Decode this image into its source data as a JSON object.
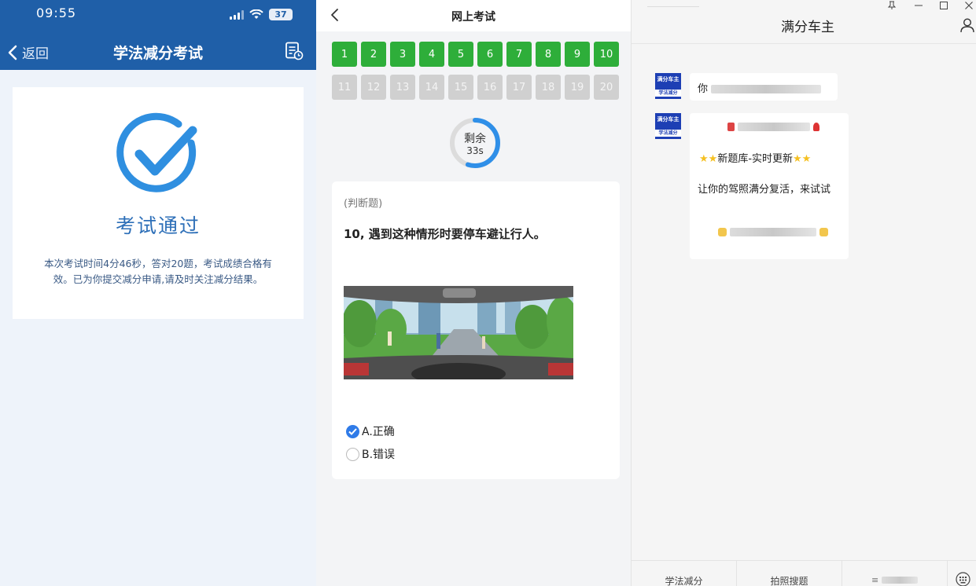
{
  "phone": {
    "status_time": "09:55",
    "battery": "37",
    "back_label": "返回",
    "title": "学法减分考试",
    "result_title": "考试通过",
    "result_detail": "本次考试时间4分46秒，答对20题，考试成绩合格有效。已为你提交减分申请,请及时关注减分结果。"
  },
  "exam": {
    "title": "网上考试",
    "questions": [
      {
        "num": "1",
        "state": "done"
      },
      {
        "num": "2",
        "state": "done"
      },
      {
        "num": "3",
        "state": "done"
      },
      {
        "num": "4",
        "state": "done"
      },
      {
        "num": "5",
        "state": "done"
      },
      {
        "num": "6",
        "state": "done"
      },
      {
        "num": "7",
        "state": "done"
      },
      {
        "num": "8",
        "state": "done"
      },
      {
        "num": "9",
        "state": "done"
      },
      {
        "num": "10",
        "state": "done"
      },
      {
        "num": "11",
        "state": "todo"
      },
      {
        "num": "12",
        "state": "todo"
      },
      {
        "num": "13",
        "state": "todo"
      },
      {
        "num": "14",
        "state": "todo"
      },
      {
        "num": "15",
        "state": "todo"
      },
      {
        "num": "16",
        "state": "todo"
      },
      {
        "num": "17",
        "state": "todo"
      },
      {
        "num": "18",
        "state": "todo"
      },
      {
        "num": "19",
        "state": "todo"
      },
      {
        "num": "20",
        "state": "todo"
      }
    ],
    "timer_label": "剩余",
    "timer_value": "33s",
    "timer_fraction": 0.55,
    "question_type": "(判断题)",
    "question_text": "10, 遇到这种情形时要停车避让行人。",
    "option_a": "A.正确",
    "option_b": "B.错误",
    "selected": "A"
  },
  "chat": {
    "title": "满分车主",
    "avatar_line1": "满分车主",
    "avatar_line2": "学法减分",
    "msg1_visible": "你",
    "msg2_line2": "新题库-实时更新",
    "msg2_line3": "让你的驾照满分复活，来试试",
    "footer_tab1": "学法减分",
    "footer_tab2": "拍照搜题",
    "colors": {
      "accent": "#1f5fa8",
      "done": "#2eae3a",
      "timer": "#2f8fe8"
    }
  }
}
